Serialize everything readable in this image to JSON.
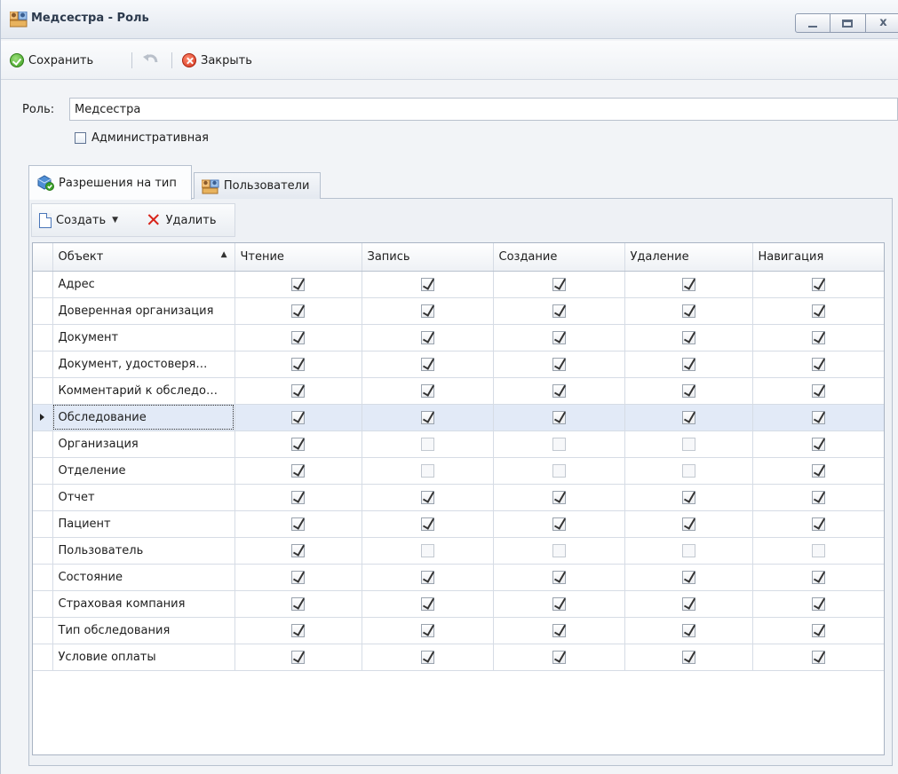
{
  "window": {
    "title": "Медсестра - Роль",
    "min_glyph": "minimize-icon",
    "max_glyph": "maximize-icon",
    "close_glyph": "x"
  },
  "toolbar": {
    "save_label": "Сохранить",
    "close_label": "Закрыть"
  },
  "form": {
    "role_label": "Роль:",
    "role_value": "Медсестра",
    "admin_label": "Административная",
    "admin_checked": false
  },
  "tabs": [
    {
      "label": "Разрешения на тип",
      "active": true
    },
    {
      "label": "Пользователи",
      "active": false
    }
  ],
  "grid_toolbar": {
    "create_label": "Создать",
    "delete_label": "Удалить"
  },
  "grid": {
    "columns": [
      "Объект",
      "Чтение",
      "Запись",
      "Создание",
      "Удаление",
      "Навигация"
    ],
    "sort_column": "Объект",
    "selected_row": 5,
    "rows": [
      {
        "name": "Адрес",
        "perms": [
          true,
          true,
          true,
          true,
          true
        ]
      },
      {
        "name": "Доверенная организация",
        "perms": [
          true,
          true,
          true,
          true,
          true
        ]
      },
      {
        "name": "Документ",
        "perms": [
          true,
          true,
          true,
          true,
          true
        ]
      },
      {
        "name": "Документ, удостоверя…",
        "perms": [
          true,
          true,
          true,
          true,
          true
        ]
      },
      {
        "name": "Комментарий к обследо…",
        "perms": [
          true,
          true,
          true,
          true,
          true
        ]
      },
      {
        "name": "Обследование",
        "perms": [
          true,
          true,
          true,
          true,
          true
        ]
      },
      {
        "name": "Организация",
        "perms": [
          true,
          false,
          false,
          false,
          true
        ]
      },
      {
        "name": "Отделение",
        "perms": [
          true,
          false,
          false,
          false,
          true
        ]
      },
      {
        "name": "Отчет",
        "perms": [
          true,
          true,
          true,
          true,
          true
        ]
      },
      {
        "name": "Пациент",
        "perms": [
          true,
          true,
          true,
          true,
          true
        ]
      },
      {
        "name": "Пользователь",
        "perms": [
          true,
          false,
          false,
          false,
          false
        ]
      },
      {
        "name": "Состояние",
        "perms": [
          true,
          true,
          true,
          true,
          true
        ]
      },
      {
        "name": "Страховая компания",
        "perms": [
          true,
          true,
          true,
          true,
          true
        ]
      },
      {
        "name": "Тип обследования",
        "perms": [
          true,
          true,
          true,
          true,
          true
        ]
      },
      {
        "name": "Условие оплаты",
        "perms": [
          true,
          true,
          true,
          true,
          true
        ]
      }
    ]
  },
  "colors": {
    "selected_row": "#e2eaf7",
    "close_red": "#d2321c",
    "save_green": "#3a9d1f"
  }
}
